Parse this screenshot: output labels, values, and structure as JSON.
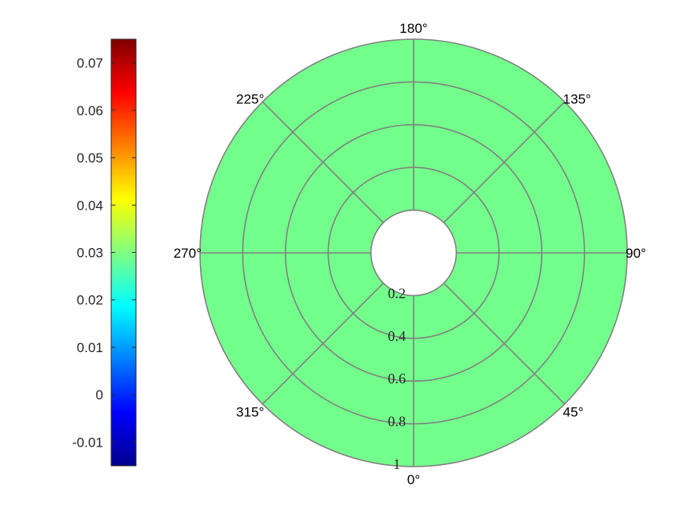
{
  "chart_data": {
    "type": "polar-heatmap",
    "fill_value": 0.03,
    "fill_color": "#73ff8c",
    "grid_color": "#808080",
    "colormap": "jet",
    "colorbar": {
      "position": "left",
      "range": [
        -0.015,
        0.075
      ],
      "ticks": [
        -0.01,
        0,
        0.01,
        0.02,
        0.03,
        0.04,
        0.05,
        0.06,
        0.07
      ],
      "tick_labels": [
        "-0.01",
        "0",
        "0.01",
        "0.02",
        "0.03",
        "0.04",
        "0.05",
        "0.06",
        "0.07"
      ]
    },
    "angular_axis": {
      "direction": "counterclockwise",
      "zero_at": "bottom",
      "ticks_deg": [
        0,
        45,
        90,
        135,
        180,
        225,
        270,
        315
      ],
      "tick_labels": [
        "0°",
        "45°",
        "90°",
        "135°",
        "180°",
        "225°",
        "270°",
        "315°"
      ]
    },
    "radial_axis": {
      "range": [
        0,
        1
      ],
      "inner_hole": 0.2,
      "ticks": [
        0.2,
        0.4,
        0.6,
        0.8,
        1
      ],
      "tick_labels": [
        "0.2",
        "0.4",
        "0.6",
        "0.8",
        "1"
      ]
    }
  }
}
